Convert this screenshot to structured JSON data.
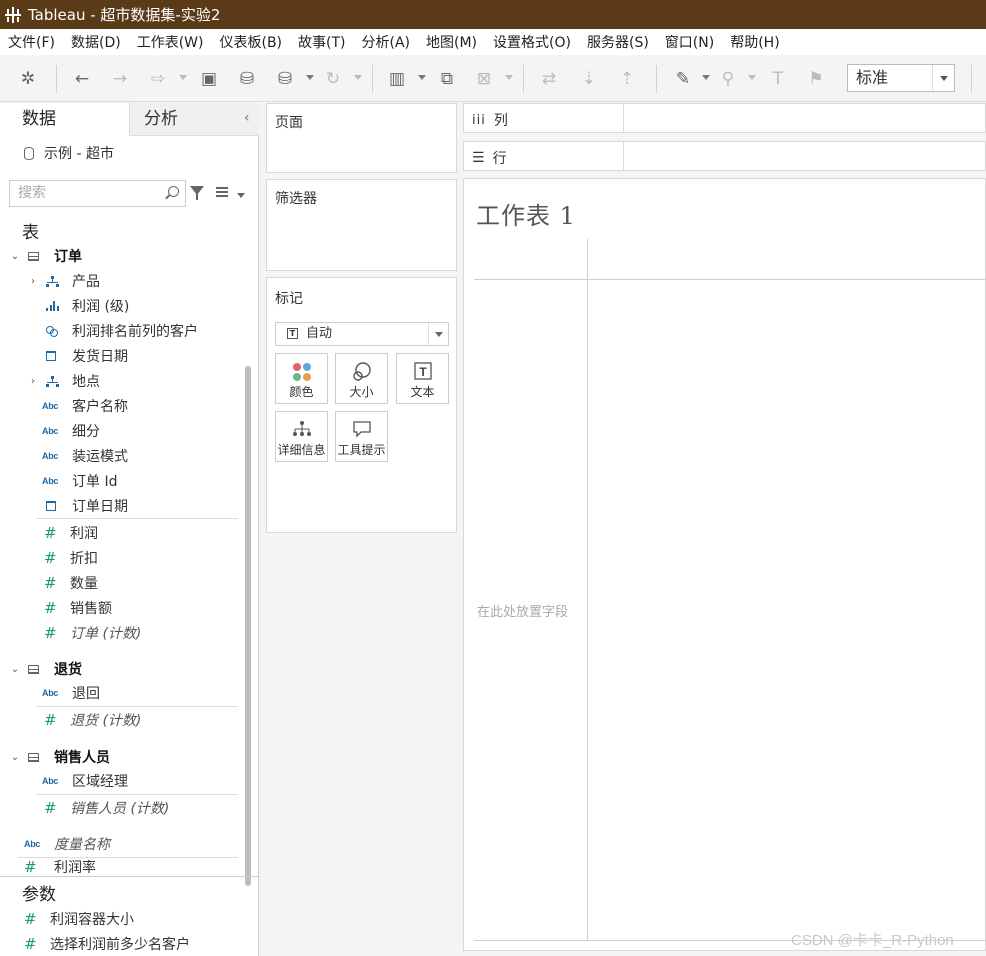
{
  "window": {
    "title": "Tableau - 超市数据集-实验2"
  },
  "menu": [
    "文件(F)",
    "数据(D)",
    "工作表(W)",
    "仪表板(B)",
    "故事(T)",
    "分析(A)",
    "地图(M)",
    "设置格式(O)",
    "服务器(S)",
    "窗口(N)",
    "帮助(H)"
  ],
  "toolbar": {
    "view_size": "标准"
  },
  "data_pane": {
    "tab_data": "数据",
    "tab_analysis": "分析",
    "datasource": "示例 - 超市",
    "search_placeholder": "搜索",
    "tables_header": "表",
    "tables": [
      {
        "name": "订单",
        "fields": [
          {
            "label": "产品",
            "icon": "hierarchy-icon",
            "expandable": true
          },
          {
            "label": "利润 (级)",
            "icon": "bins-icon"
          },
          {
            "label": "利润排名前列的客户",
            "icon": "set-icon"
          },
          {
            "label": "发货日期",
            "icon": "date-icon"
          },
          {
            "label": "地点",
            "icon": "hierarchy-icon",
            "expandable": true
          },
          {
            "label": "客户名称",
            "icon": "abc-icon"
          },
          {
            "label": "细分",
            "icon": "abc-icon"
          },
          {
            "label": "装运模式",
            "icon": "abc-icon"
          },
          {
            "label": "订单 Id",
            "icon": "abc-icon"
          },
          {
            "label": "订单日期",
            "icon": "date-icon"
          },
          {
            "label": "利润",
            "icon": "number-icon"
          },
          {
            "label": "折扣",
            "icon": "number-icon"
          },
          {
            "label": "数量",
            "icon": "number-icon"
          },
          {
            "label": "销售额",
            "icon": "number-icon"
          },
          {
            "label": "订单 (计数)",
            "icon": "number-icon",
            "italic": true
          }
        ]
      },
      {
        "name": "退货",
        "fields": [
          {
            "label": "退回",
            "icon": "abc-icon"
          },
          {
            "label": "退货 (计数)",
            "icon": "number-icon",
            "italic": true
          }
        ]
      },
      {
        "name": "销售人员",
        "fields": [
          {
            "label": "区域经理",
            "icon": "abc-icon"
          },
          {
            "label": "销售人员 (计数)",
            "icon": "number-icon",
            "italic": true
          }
        ]
      }
    ],
    "measure_names": "度量名称",
    "profit_ratio": "利润率",
    "params_header": "参数",
    "params": [
      "利润容器大小",
      "选择利润前多少名客户"
    ]
  },
  "shelves": {
    "pages": "页面",
    "filters": "筛选器",
    "marks": "标记",
    "marks_type": "自动",
    "mark_buttons": [
      "颜色",
      "大小",
      "文本",
      "详细信息",
      "工具提示"
    ],
    "columns": "列",
    "rows": "行"
  },
  "canvas": {
    "sheet_title": "工作表 1",
    "drop_field": "在此处放置字段"
  },
  "watermark": "CSDN @卡卡_R-Python"
}
